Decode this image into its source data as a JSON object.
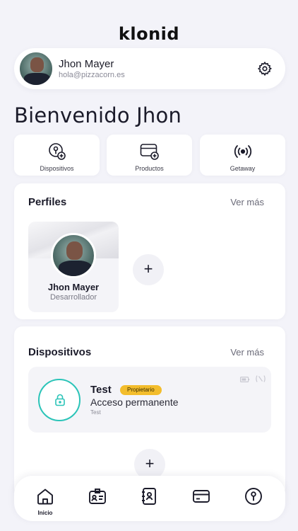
{
  "app": {
    "logo": "klonid"
  },
  "user": {
    "name": "Jhon Mayer",
    "email": "hola@pizzacorn.es"
  },
  "welcome": "Bienvenido Jhon",
  "quick_actions": [
    {
      "label": "Dispositivos",
      "icon": "key-add-icon"
    },
    {
      "label": "Productos",
      "icon": "card-add-icon"
    },
    {
      "label": "Getaway",
      "icon": "broadcast-icon"
    }
  ],
  "profiles": {
    "title": "Perfiles",
    "more": "Ver más",
    "items": [
      {
        "name": "Jhon Mayer",
        "role": "Desarrollador"
      }
    ],
    "add_label": "+"
  },
  "devices": {
    "title": "Dispositivos",
    "more": "Ver más",
    "items": [
      {
        "name": "Test",
        "badge": "Propietario",
        "access": "Acceso permanente",
        "sub": "Test"
      }
    ],
    "add_label": "+"
  },
  "nav": {
    "active_label": "Inicio"
  },
  "colors": {
    "accent_teal": "#2bc4b8",
    "badge_yellow": "#f3bd2c",
    "background": "#f3f3f9"
  }
}
